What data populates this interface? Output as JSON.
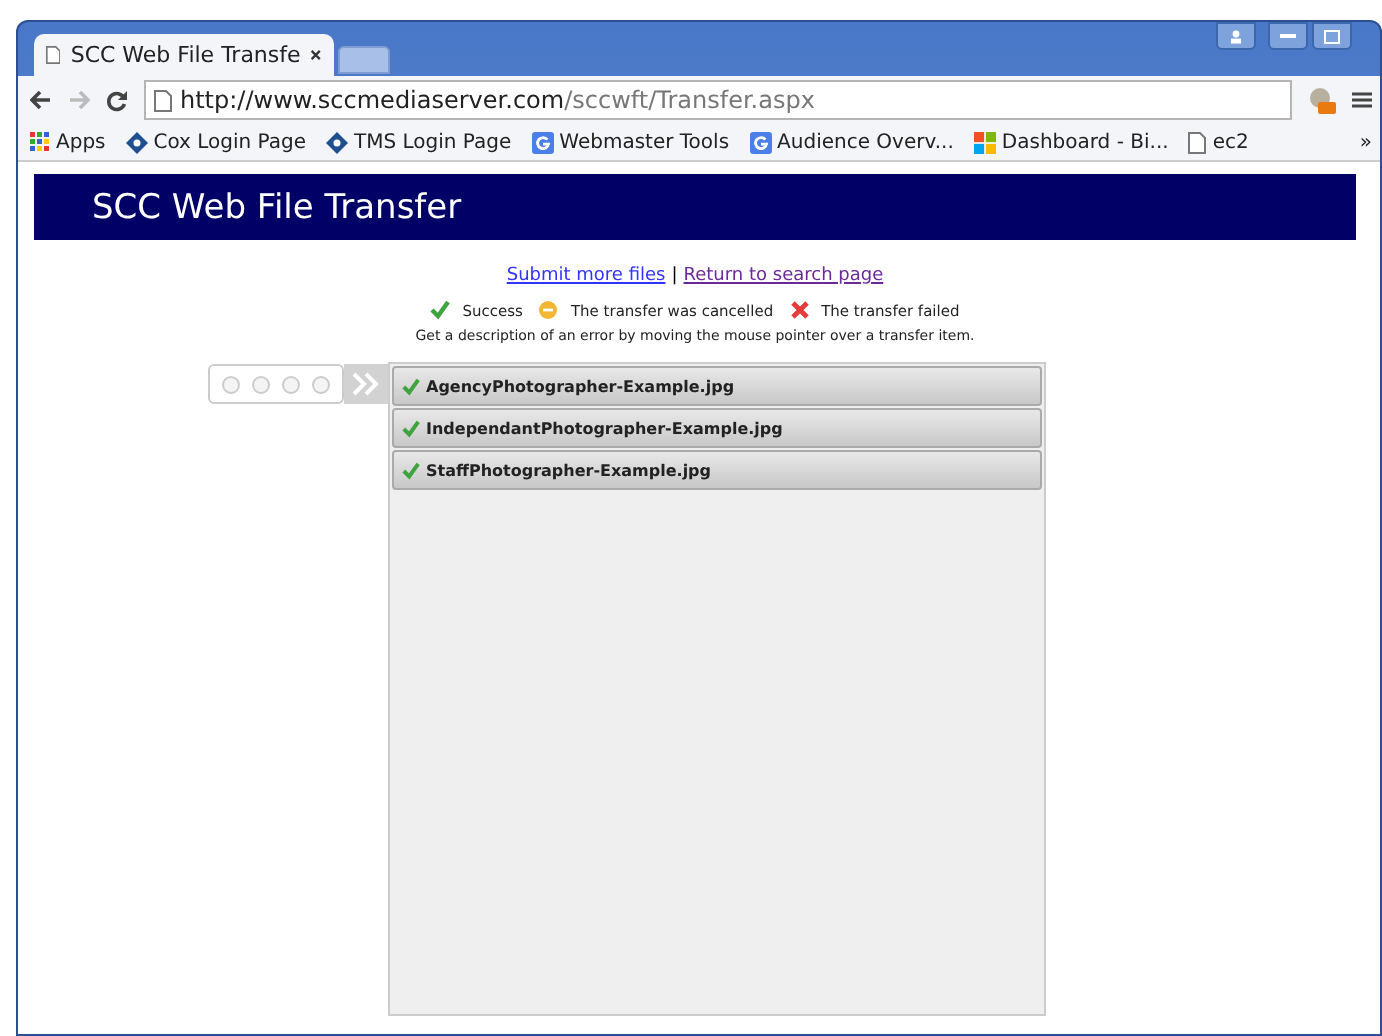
{
  "browser": {
    "tab_title": "SCC Web File Transfe",
    "url_host": "http://www.sccmediaserver.com",
    "url_path": "/sccwft/Transfer.aspx",
    "bookmarks": [
      {
        "label": "Apps",
        "kind": "apps"
      },
      {
        "label": "Cox Login Page",
        "kind": "diamond"
      },
      {
        "label": "TMS Login Page",
        "kind": "diamond"
      },
      {
        "label": "Webmaster Tools",
        "kind": "google"
      },
      {
        "label": "Audience Overv...",
        "kind": "google"
      },
      {
        "label": "Dashboard - Bi...",
        "kind": "windows"
      },
      {
        "label": "ec2",
        "kind": "page"
      }
    ],
    "more": "»"
  },
  "header": {
    "title": "SCC Web File Transfer"
  },
  "links": [
    {
      "label": "Submit more files",
      "visited": false
    },
    {
      "label": "Return to search page",
      "visited": true
    }
  ],
  "link_separator": "|",
  "legend": [
    {
      "kind": "success",
      "label": "Success"
    },
    {
      "kind": "cancelled",
      "label": "The transfer was cancelled"
    },
    {
      "kind": "failed",
      "label": "The transfer failed"
    }
  ],
  "hint": "Get a description of an error by moving the mouse pointer over a transfer item.",
  "transfers": [
    {
      "name": "AgencyPhotographer-Example.jpg",
      "kind": "success"
    },
    {
      "name": "IndependantPhotographer-Example.jpg",
      "kind": "success"
    },
    {
      "name": "StaffPhotographer-Example.jpg",
      "kind": "success"
    }
  ]
}
